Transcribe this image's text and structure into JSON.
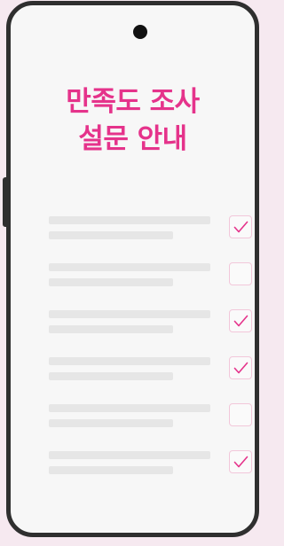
{
  "title": {
    "line1": "만족도 조사",
    "line2": "설문 안내"
  },
  "survey_items": [
    {
      "checked": true
    },
    {
      "checked": false
    },
    {
      "checked": true
    },
    {
      "checked": true
    },
    {
      "checked": false
    },
    {
      "checked": true
    }
  ],
  "colors": {
    "accent": "#e5338b",
    "phone_frame": "#2f2f2f",
    "background": "#f6e9f0",
    "screen": "#f7f7f7",
    "placeholder_bar": "#e6e6e6",
    "checkbox_border": "#f2c7da"
  },
  "icons": {
    "check": "checkmark-icon",
    "camera": "front-camera-icon"
  }
}
